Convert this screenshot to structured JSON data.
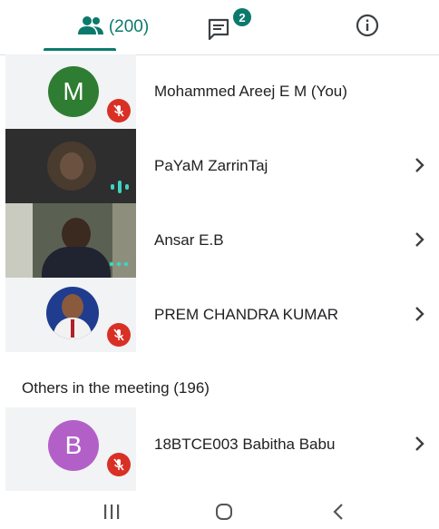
{
  "tabs": {
    "people_count": "(200)",
    "chat_badge": "2"
  },
  "participants": [
    {
      "name": "Mohammed Areej E M (You)",
      "initial": "M",
      "avatar_color": "#2f7d32",
      "muted": true
    },
    {
      "name": "PaYaM ZarrinTaj",
      "speaking": true
    },
    {
      "name": "Ansar E.B"
    },
    {
      "name": "PREM CHANDRA KUMAR",
      "muted": true
    }
  ],
  "others_section": {
    "title": "Others in the meeting (196)"
  },
  "others": [
    {
      "name": "18BTCE003 Babitha Babu",
      "initial": "B",
      "avatar_color": "#b260c8",
      "muted": true
    }
  ],
  "colors": {
    "accent": "#0b7a6d",
    "muted_red": "#d93025"
  }
}
